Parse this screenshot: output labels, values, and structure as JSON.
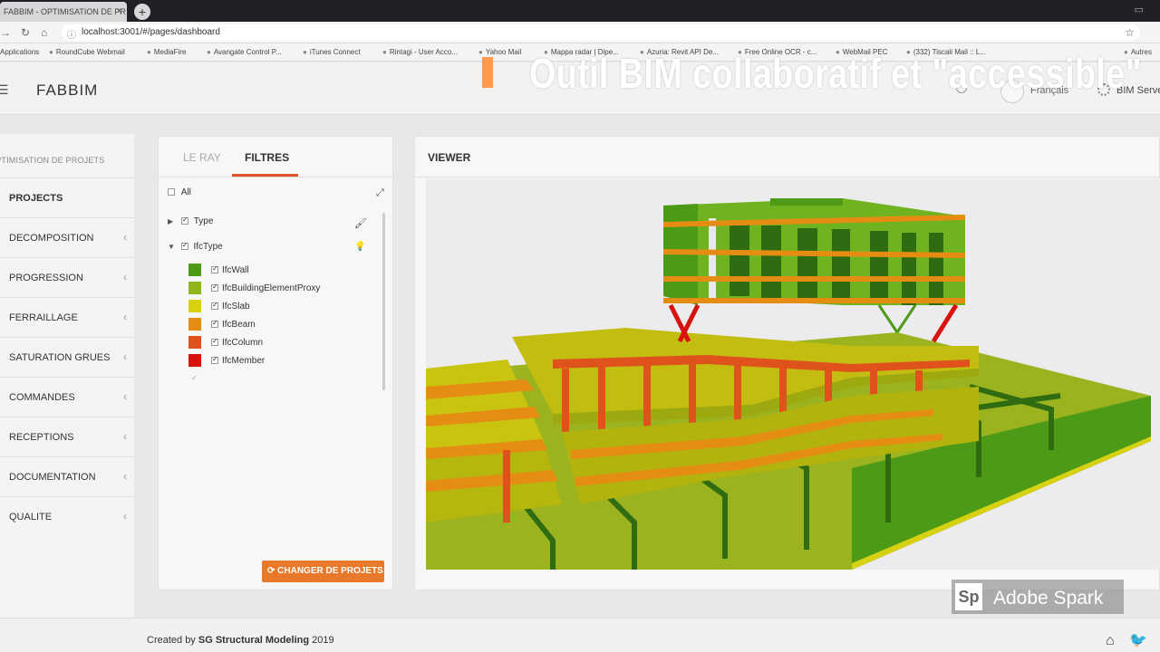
{
  "browser": {
    "tab_title": "FABBIM - OPTIMISATION DE PR",
    "tab_close": "×",
    "new_tab": "+",
    "url": "localhost:3001/#/pages/dashboard",
    "bookmarks": [
      "Applications",
      "RoundCube Webmail",
      "MediaFire",
      "Avangate Control P...",
      "iTunes Connect",
      "Rintagi - User Acco...",
      "Yahoo Mail",
      "Mappa radar | Dipe...",
      "Azuria: Revit API De...",
      "Free Online OCR - c...",
      "WebMail PEC",
      "(332) Tiscali Mail :: L...",
      "Autres"
    ]
  },
  "header": {
    "logo": "FABBIM",
    "overlay_title": "Outil BIM collaboratif et \"accessible\"",
    "language": "Français",
    "server": "BIM Server"
  },
  "sidebar": {
    "title": "OPTIMISATION DE PROJETS",
    "items": [
      {
        "label": "PROJECTS",
        "active": true
      },
      {
        "label": "DECOMPOSITION"
      },
      {
        "label": "PROGRESSION"
      },
      {
        "label": "FERRAILLAGE"
      },
      {
        "label": "SATURATION GRUES"
      },
      {
        "label": "COMMANDES"
      },
      {
        "label": "RECEPTIONS"
      },
      {
        "label": "DOCUMENTATION"
      },
      {
        "label": "QUALITE"
      }
    ]
  },
  "filters": {
    "tabs": [
      "LE RAY",
      "FILTRES"
    ],
    "active_tab": "FILTRES",
    "all_label": "All",
    "groups": [
      {
        "label": "Type",
        "expanded": false
      },
      {
        "label": "IfcType",
        "expanded": true
      }
    ],
    "types": [
      {
        "label": "IfcWall",
        "color": "#4d9a17"
      },
      {
        "label": "IfcBuildingElementProxy",
        "color": "#8fb61a"
      },
      {
        "label": "IfcSlab",
        "color": "#d8d10f"
      },
      {
        "label": "IfcBeam",
        "color": "#e48d12"
      },
      {
        "label": "IfcColumn",
        "color": "#e0521c"
      },
      {
        "label": "IfcMember",
        "color": "#d8130e"
      }
    ],
    "button": "CHANGER DE PROJETS"
  },
  "viewer": {
    "title": "VIEWER"
  },
  "footer": {
    "prefix": "Created by",
    "author": "SG Structural Modeling",
    "year": "2019"
  },
  "watermark": "Adobe Spark"
}
